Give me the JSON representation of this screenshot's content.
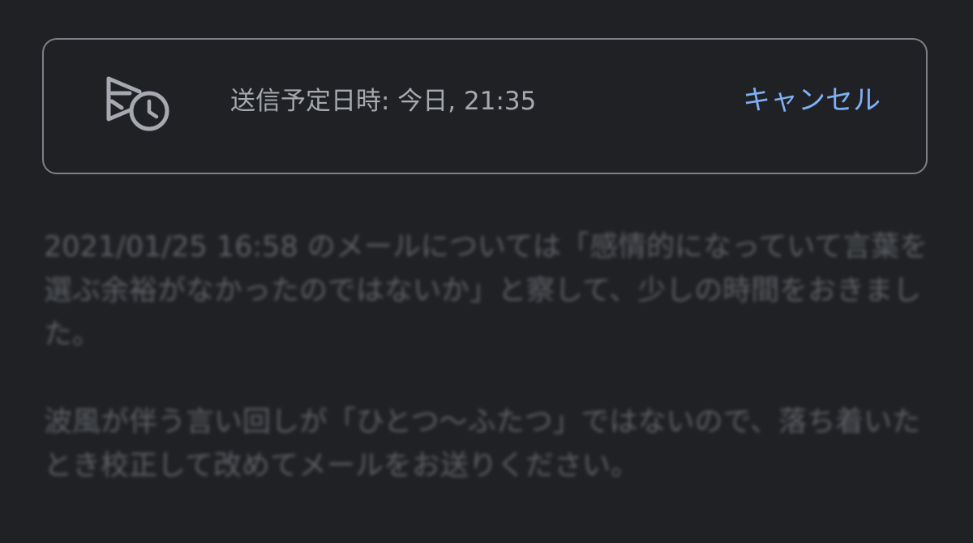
{
  "schedule": {
    "label": "送信予定日時: 今日, 21:35",
    "cancel_label": "キャンセル",
    "icon": "scheduled-send-icon"
  },
  "email": {
    "paragraphs": [
      "2021/01/25 16:58 のメールについては「感情的になっていて言葉を選ぶ余裕がなかったのではないか」と察して、少しの時間をおきました。",
      "波風が伴う言い回しが「ひとつ〜ふたつ」ではないので、落ち着いたとき校正して改めてメールをお送りください。"
    ]
  },
  "colors": {
    "background": "#202124",
    "accent": "#7fb0f5",
    "border": "#7d8086"
  }
}
